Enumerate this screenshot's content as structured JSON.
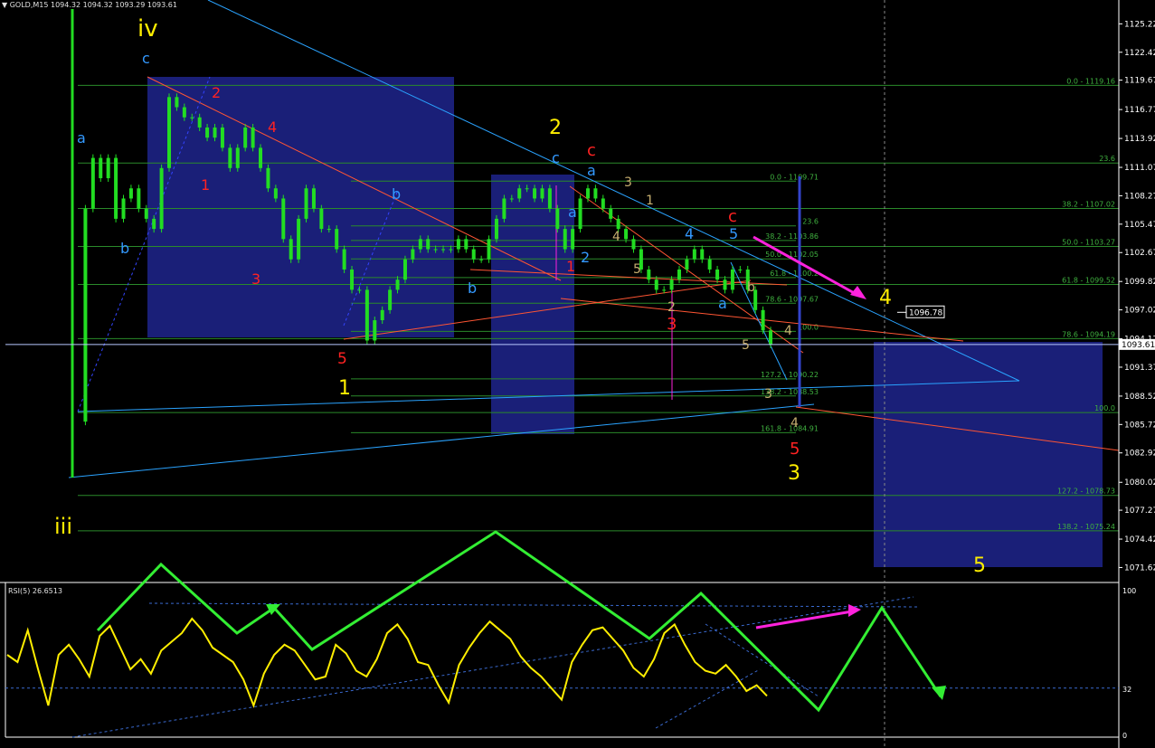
{
  "header": {
    "symbol": "GOLD,M15",
    "ohlc": "1094.32 1094.32 1093.29 1093.61"
  },
  "rsi_header": "RSI(5) 26.6513",
  "colors": {
    "background": "#000000",
    "candle": "#22dd22",
    "box": "#1a1f78",
    "trendline_blue": "#2aa3ff",
    "trendline_red": "#ff5533",
    "fib_line": "#2a8a2a",
    "rsi_line": "#ffee00",
    "green_arrow": "#33ee33",
    "magenta": "#ff22dd",
    "wave_yellow": "#ffee00",
    "wave_red": "#ff2222",
    "wave_blue": "#3399ff",
    "wave_tan": "#c8b070"
  },
  "chart_data": [
    {
      "type": "candlestick",
      "symbol": "GOLD",
      "timeframe": "M15",
      "ylim": [
        1070.5,
        1126.5
      ],
      "y_ticks": [
        "1125.22",
        "1122.42",
        "1119.67",
        "1116.77",
        "1113.92",
        "1111.07",
        "1108.27",
        "1105.47",
        "1102.67",
        "1099.82",
        "1097.02",
        "1094.17",
        "1091.37",
        "1088.52",
        "1085.72",
        "1082.92",
        "1080.02",
        "1077.27",
        "1074.42",
        "1071.62"
      ],
      "current_price": "1093.61",
      "marked_price": "1096.78",
      "close_series": [
        1086,
        1107,
        1112,
        1110,
        1112,
        1106,
        1108,
        1109,
        1107,
        1106,
        1105,
        1111,
        1118,
        1117,
        1116,
        1116,
        1115,
        1114,
        1115,
        1113,
        1111,
        1113,
        1115,
        1113,
        1111,
        1109,
        1108,
        1104,
        1102,
        1106,
        1109,
        1107,
        1105,
        1105,
        1103,
        1101,
        1099,
        1099,
        1094,
        1096,
        1097,
        1099,
        1100,
        1102,
        1103,
        1104,
        1103,
        1103,
        1103,
        1103,
        1104,
        1103,
        1102,
        1102,
        1104,
        1106,
        1108,
        1108,
        1109,
        1109,
        1108,
        1109,
        1107,
        1105,
        1103,
        1105,
        1108,
        1109,
        1108,
        1107,
        1106,
        1105,
        1104,
        1103,
        1101,
        1100,
        1099,
        1099,
        1100,
        1101,
        1102,
        1103,
        1102,
        1101,
        1100,
        1099,
        1101,
        1101,
        1099,
        1097,
        1095,
        1093.61
      ],
      "fib_labels": [
        "0.0 - 1119.16",
        "23.6",
        "38.2 - 1107.02",
        "50.0 - 1103.27",
        "61.8 - 1099.52",
        "78.6 - 1094.19",
        "100.0",
        "127.2 - 1078.73",
        "138.2 - 1075.24",
        "0.0 - 1109.71",
        "23.6",
        "38.2 - 1103.86",
        "50.0 - 1102.05",
        "61.8 - 1100.2",
        "78.6 - 1097.67",
        "100.0",
        "127.2 - 1090.22",
        "138.2 - 1088.53",
        "161.8 - 1084.91"
      ],
      "wave_labels": [
        "iv",
        "iii",
        "c",
        "a",
        "b",
        "2",
        "1",
        "4",
        "3",
        "5",
        "1",
        "2",
        "c",
        "c",
        "a",
        "b",
        "b",
        "a",
        "2",
        "1",
        "3",
        "4",
        "5",
        "1",
        "2",
        "3",
        "4",
        "5",
        "a",
        "c",
        "b",
        "4",
        "5",
        "3",
        "4",
        "5"
      ]
    },
    {
      "type": "line",
      "name": "RSI(5)",
      "value": "26.6513",
      "ylim": [
        0,
        100
      ],
      "y_ticks": [
        "100",
        "32",
        "0"
      ],
      "values": [
        55,
        50,
        72,
        45,
        20,
        55,
        62,
        52,
        40,
        68,
        75,
        60,
        45,
        52,
        42,
        58,
        64,
        70,
        80,
        72,
        60,
        55,
        50,
        38,
        20,
        42,
        55,
        62,
        58,
        48,
        38,
        40,
        62,
        56,
        44,
        40,
        52,
        70,
        76,
        66,
        50,
        48,
        34,
        22,
        48,
        60,
        70,
        78,
        72,
        66,
        54,
        46,
        40,
        32,
        24,
        50,
        62,
        72,
        74,
        66,
        58,
        46,
        40,
        52,
        70,
        76,
        62,
        50,
        44,
        42,
        48,
        40,
        30,
        34,
        26.65
      ]
    }
  ]
}
